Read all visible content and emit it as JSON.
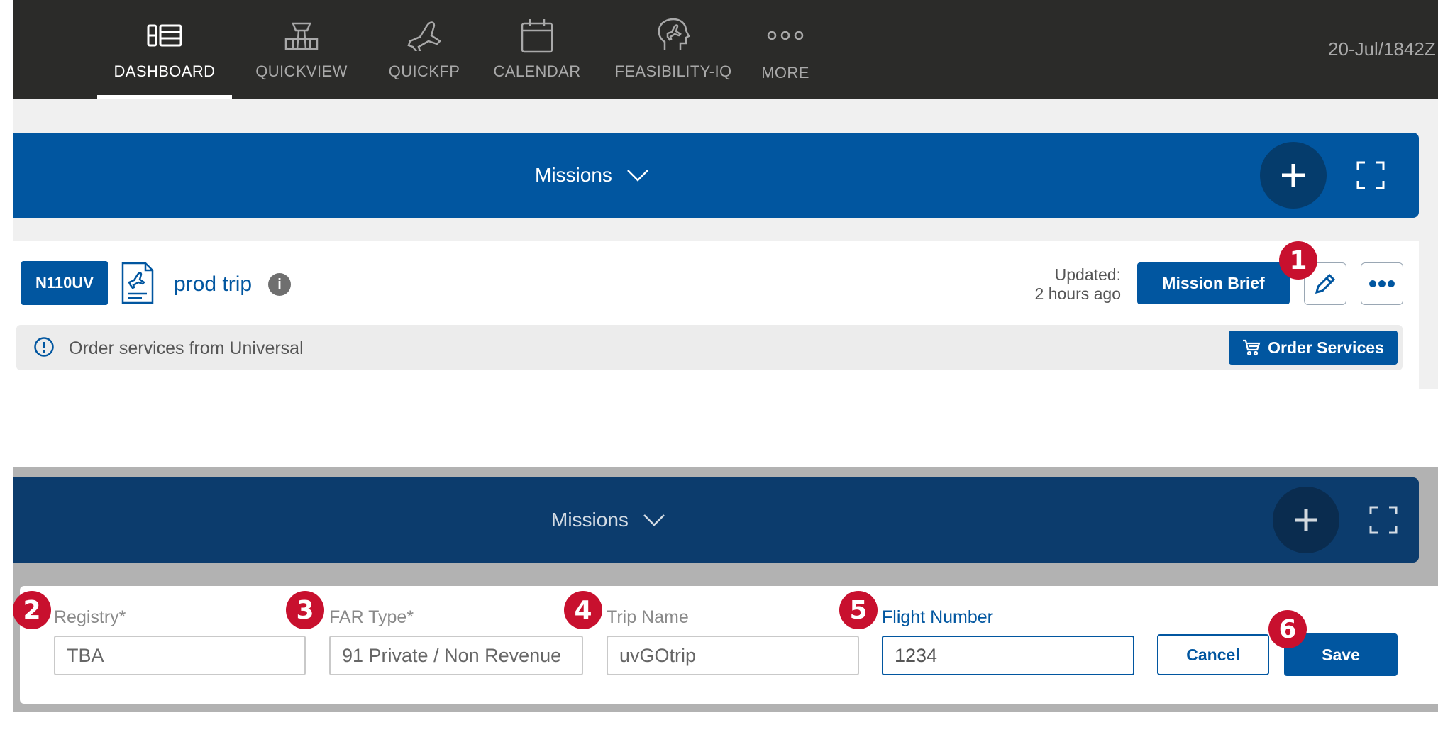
{
  "nav": {
    "items": [
      {
        "label": "DASHBOARD",
        "icon": "dashboard-icon",
        "active": true
      },
      {
        "label": "QUICKVIEW",
        "icon": "control-tower-icon",
        "active": false
      },
      {
        "label": "QUICKFP",
        "icon": "airplane-icon",
        "active": false
      },
      {
        "label": "CALENDAR",
        "icon": "calendar-icon",
        "active": false
      },
      {
        "label": "FEASIBILITY-IQ",
        "icon": "head-plane-icon",
        "active": false
      },
      {
        "label": "MORE",
        "icon": "more-dots-icon",
        "active": false
      }
    ],
    "date_text": "20-Jul/1842Z"
  },
  "missions_panel": {
    "title": "Missions",
    "add_icon": "plus-icon",
    "expand_icon": "expand-icon"
  },
  "mission_card": {
    "tail_number": "N110UV",
    "trip_icon": "trip-document-icon",
    "trip_name": "prod trip",
    "info_icon": "info-icon",
    "updated_label": "Updated:",
    "updated_time": "2 hours ago",
    "mission_brief_label": "Mission Brief",
    "edit_icon": "pencil-icon",
    "more_icon": "ellipsis-icon",
    "services_text": "Order services from Universal",
    "services_alert_icon": "alert-circle-icon",
    "order_services_label": "Order Services",
    "cart_icon": "cart-icon"
  },
  "edit_form": {
    "panel_title": "Missions",
    "registry": {
      "label": "Registry*",
      "value": "TBA"
    },
    "far_type": {
      "label": "FAR Type*",
      "value": "91 Private / Non Revenue"
    },
    "trip_name": {
      "label": "Trip Name",
      "value": "uvGOtrip"
    },
    "flight_number": {
      "label": "Flight Number",
      "value": "1234"
    },
    "cancel_label": "Cancel",
    "save_label": "Save"
  },
  "callouts": [
    "1",
    "2",
    "3",
    "4",
    "5",
    "6"
  ],
  "colors": {
    "primary_blue": "#0156a0",
    "nav_bg": "#2b2b29",
    "callout_red": "#c8102e",
    "dimmed_blue": "#0c3c6d"
  }
}
